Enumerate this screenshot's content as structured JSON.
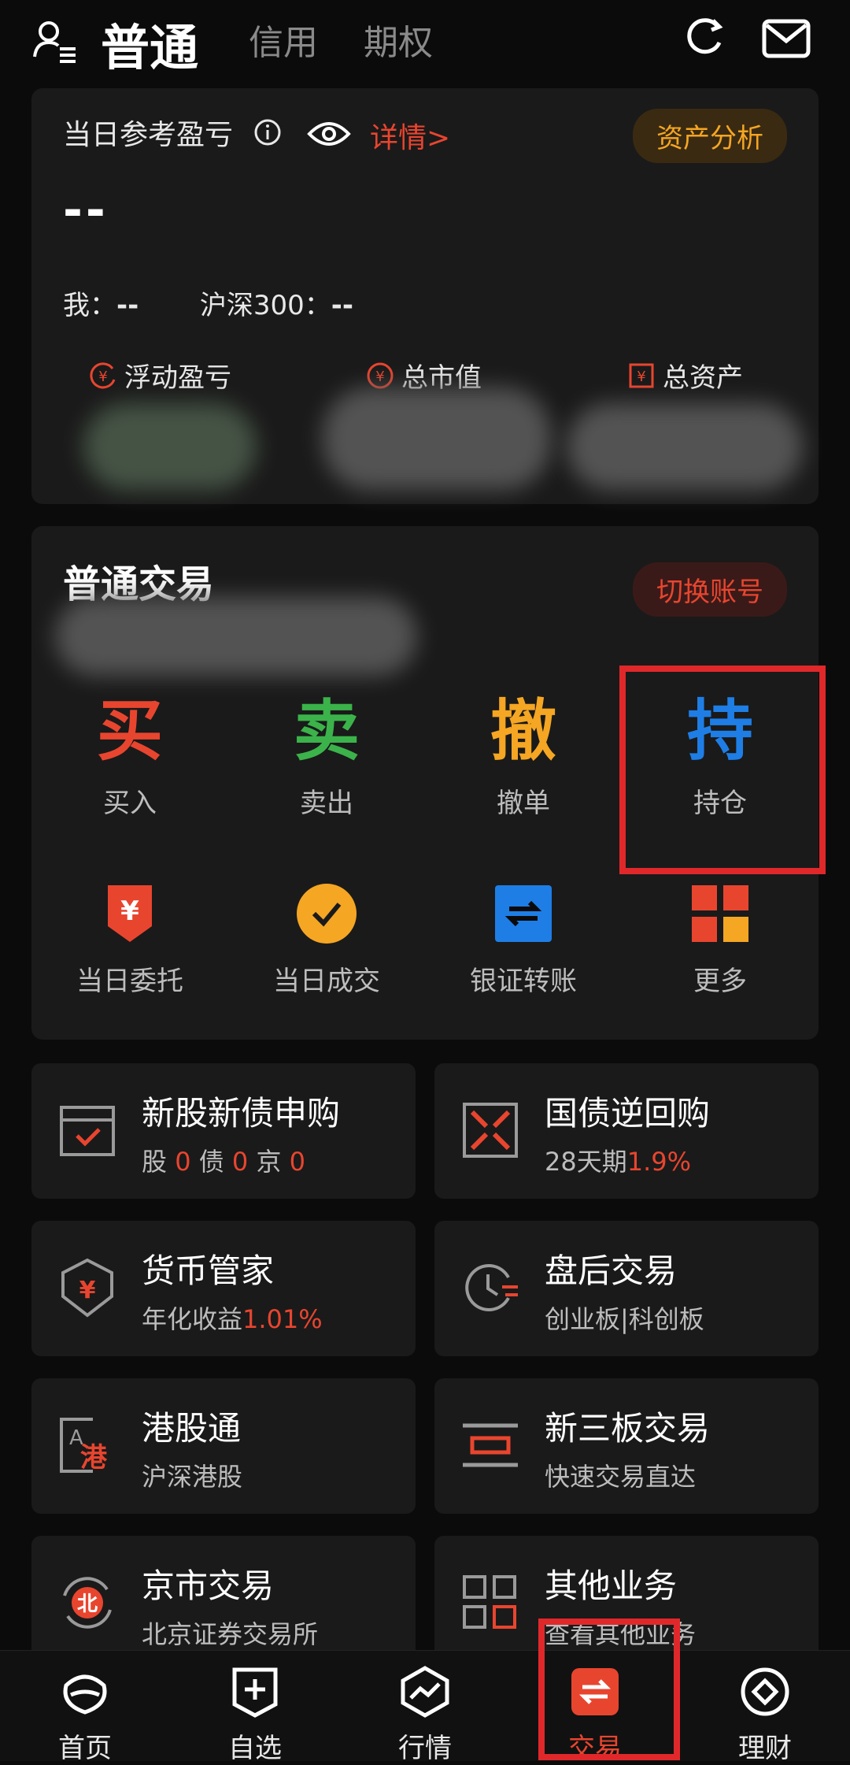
{
  "header": {
    "tabs": [
      "普通",
      "信用",
      "期权"
    ],
    "active_tab": "普通"
  },
  "pnl": {
    "title": "当日参考盈亏",
    "detail": "详情>",
    "analysis_button": "资产分析",
    "value": "--",
    "mine_label": "我：",
    "mine_value": "--",
    "index_label": "沪深300：",
    "index_value": "--",
    "stats": [
      "浮动盈亏",
      "总市值",
      "总资产"
    ]
  },
  "trade": {
    "title": "普通交易",
    "switch_button": "切换账号",
    "actions": [
      {
        "char": "买",
        "label": "买入",
        "color": "#e8452f"
      },
      {
        "char": "卖",
        "label": "卖出",
        "color": "#3bb34a"
      },
      {
        "char": "撤",
        "label": "撤单",
        "color": "#f5a623"
      },
      {
        "char": "持",
        "label": "持仓",
        "color": "#1e7ee6"
      }
    ],
    "tools": [
      "当日委托",
      "当日成交",
      "银证转账",
      "更多"
    ]
  },
  "tiles": {
    "ipo": {
      "title": "新股新债申购",
      "sub_a": "股",
      "val_a": "0",
      "sub_b": "债",
      "val_b": "0",
      "sub_c": "京",
      "val_c": "0"
    },
    "repo": {
      "title": "国债逆回购",
      "sub": "28天期",
      "rate": "1.9%"
    },
    "money": {
      "title": "货币管家",
      "sub": "年化收益",
      "rate": "1.01%"
    },
    "afterhours": {
      "title": "盘后交易",
      "sub": "创业板|科创板"
    },
    "hk": {
      "title": "港股通",
      "sub": "沪深港股",
      "icon_text": "港"
    },
    "neeq": {
      "title": "新三板交易",
      "sub": "快速交易直达"
    },
    "bj": {
      "title": "京市交易",
      "sub": "北京证券交易所",
      "icon_text": "北"
    },
    "other": {
      "title": "其他业务",
      "sub": "查看其他业务"
    }
  },
  "nav": [
    "首页",
    "自选",
    "行情",
    "交易",
    "理财"
  ],
  "colors": {
    "accent": "#e8452f",
    "bg": "#0b0b0b",
    "card": "#1a1a1a",
    "gold": "#f5a623",
    "highlight": "#e0282b"
  }
}
